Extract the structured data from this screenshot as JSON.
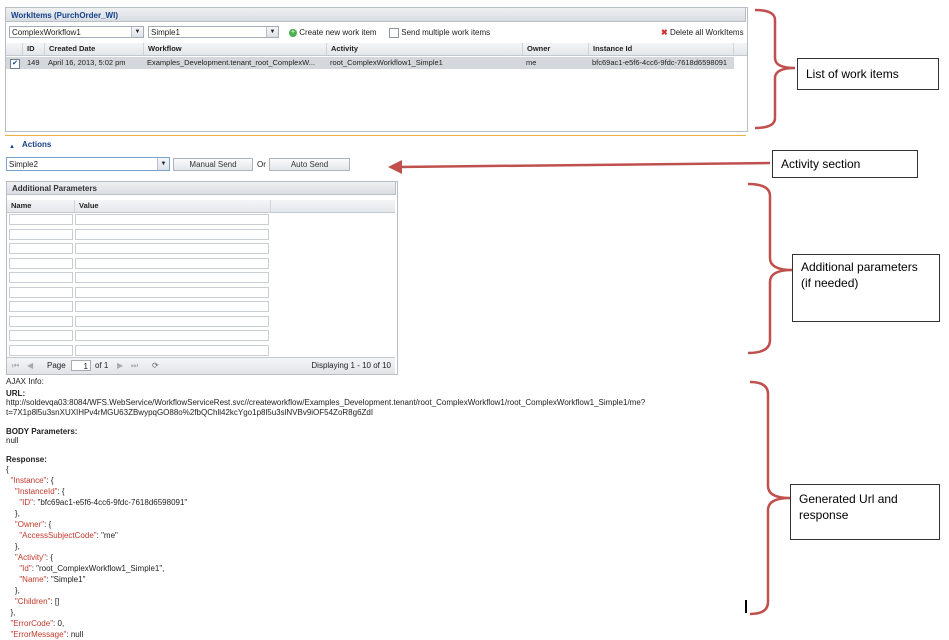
{
  "workitems": {
    "panel_title": "WorkItems (PurchOrder_WI)",
    "workflow_select": "ComplexWorkflow1",
    "activity_select": "Simple1",
    "create_label": "Create new work item",
    "send_multiple_label": "Send multiple work items",
    "delete_all_label": "Delete all WorkItems",
    "columns": [
      "ID",
      "Created Date",
      "Workflow",
      "Activity",
      "Owner",
      "Instance Id"
    ],
    "rows": [
      {
        "id": "149",
        "created": "April 16, 2013, 5:02 pm",
        "workflow": "Examples_Development.tenant_root_ComplexW...",
        "activity": "root_ComplexWorkflow1_Simple1",
        "owner": "me",
        "instance": "bfc69ac1-e5f6-4cc6-9fdc-7618d6598091",
        "checked": true
      }
    ]
  },
  "actions": {
    "title": "Actions",
    "activity_select": "Simple2",
    "manual_send": "Manual Send",
    "or_label": "Or",
    "auto_send": "Auto Send"
  },
  "params": {
    "title": "Additional Parameters",
    "col_name": "Name",
    "col_value": "Value",
    "row_count": 10,
    "page_label": "Page",
    "page_value": "1",
    "of_label": "of 1",
    "displaying": "Displaying 1 - 10 of 10"
  },
  "ajax": {
    "info_label": "AJAX Info:",
    "url_label": "URL:",
    "url_line1": "http://soldevqa03:8084/WFS.WebService/WorkflowServiceRest.svc//createworkflow/Examples_Development.tenant/root_ComplexWorkflow1/root_ComplexWorkflow1_Simple1/me?",
    "url_line2": "t=7X1p8l5u3snXUXIHPv4rMGU63ZBwypqGO88o%2fbQChll42kcYgo1p8l5u3slNVBv9iOF54ZoR8g6ZdI",
    "body_label": "BODY Parameters:",
    "body_value": "null",
    "response_label": "Response:",
    "response_lines": [
      {
        "t": "{",
        "k": false
      },
      {
        "t": "  \"Instance\": {",
        "k": true
      },
      {
        "t": "    \"InstanceId\": {",
        "k": true
      },
      {
        "t": "      \"ID\": \"bfc69ac1-e5f6-4cc6-9fdc-7618d6598091\"",
        "k": true
      },
      {
        "t": "    },",
        "k": false
      },
      {
        "t": "    \"Owner\": {",
        "k": true
      },
      {
        "t": "      \"AccessSubjectCode\": \"me\"",
        "k": true
      },
      {
        "t": "    },",
        "k": false
      },
      {
        "t": "    \"Activity\": {",
        "k": true
      },
      {
        "t": "      \"Id\": \"root_ComplexWorkflow1_Simple1\",",
        "k": true
      },
      {
        "t": "      \"Name\": \"Simple1\"",
        "k": true
      },
      {
        "t": "    },",
        "k": false
      },
      {
        "t": "    \"Children\": []",
        "k": true
      },
      {
        "t": "  },",
        "k": false
      },
      {
        "t": "  \"ErrorCode\": 0,",
        "k": true
      },
      {
        "t": "  \"ErrorMessage\": null",
        "k": true
      }
    ]
  },
  "callouts": {
    "list": "List of work items",
    "activity": "Activity section",
    "additional": "Additional parameters (if needed)",
    "generated": "Generated Url and response"
  },
  "colors": {
    "bracket": "#c0504d",
    "arrow": "#c0504d",
    "accent": "#15428b"
  }
}
